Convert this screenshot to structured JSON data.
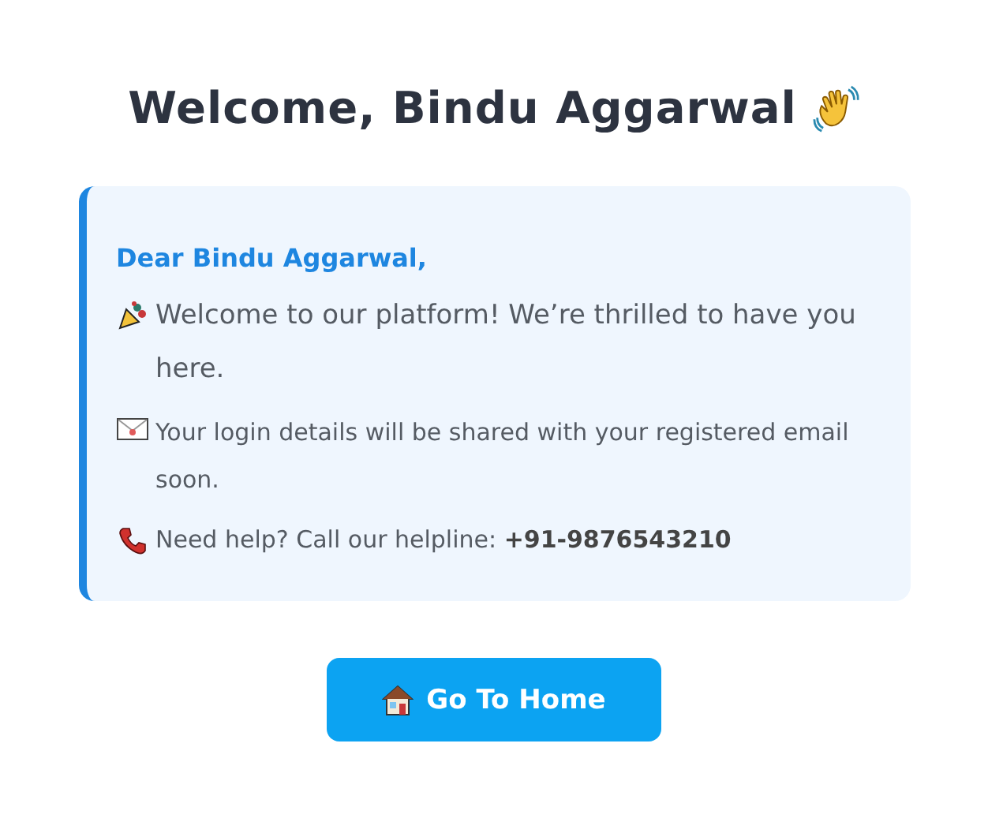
{
  "heading": "Welcome, Bindu Aggarwal",
  "card": {
    "greeting": "Dear Bindu Aggarwal,",
    "paragraphs": [
      {
        "kind": "party",
        "text": "Welcome to our platform! We’re thrilled to have you here."
      },
      {
        "kind": "mail",
        "text": "Your login details will be shared with your registered email soon."
      },
      {
        "kind": "phone",
        "text": "Need help? Call our helpline: **+91-9876543210**"
      }
    ]
  },
  "button": {
    "label": "Go To Home"
  }
}
